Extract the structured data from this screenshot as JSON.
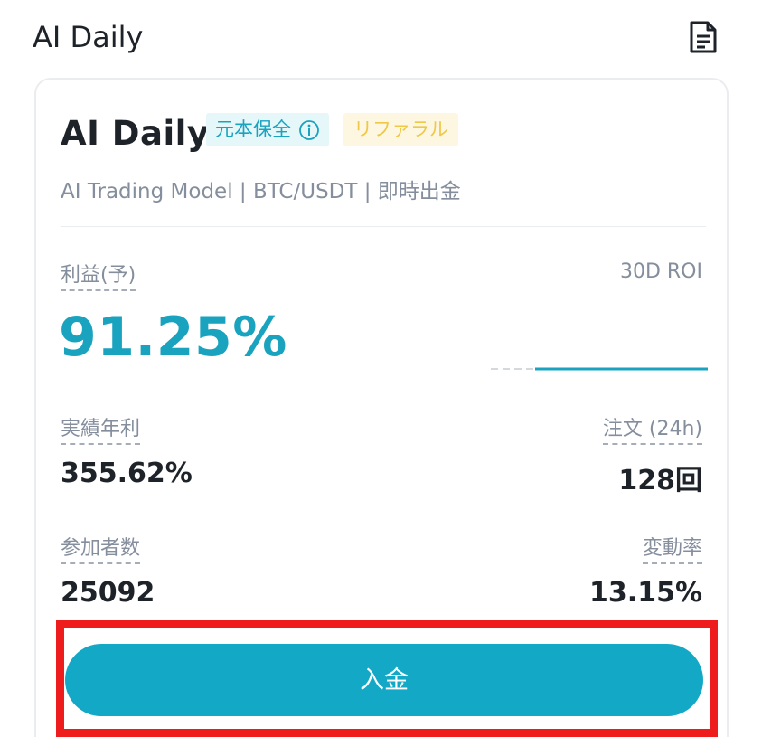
{
  "header": {
    "title": "AI Daily",
    "doc_icon": "document-icon"
  },
  "card": {
    "title": "AI Daily",
    "badges": {
      "protect": "元本保全",
      "protect_icon": "info-icon",
      "referral": "リファラル"
    },
    "subtitle": "AI Trading Model | BTC/USDT | 即時出金",
    "profit": {
      "label": "利益(予)",
      "value": "91.25%",
      "roi_label": "30D ROI"
    },
    "stats": {
      "annual_label": "実績年利",
      "annual_value": "355.62%",
      "orders_label": "注文 (24h)",
      "orders_value": "128回",
      "participants_label": "参加者数",
      "participants_value": "25092",
      "volatility_label": "変動率",
      "volatility_value": "13.15%"
    },
    "deposit_button": "入金"
  },
  "colors": {
    "accent": "#12a8c6",
    "highlight": "#ee1c1c",
    "referral": "#f0c847"
  }
}
